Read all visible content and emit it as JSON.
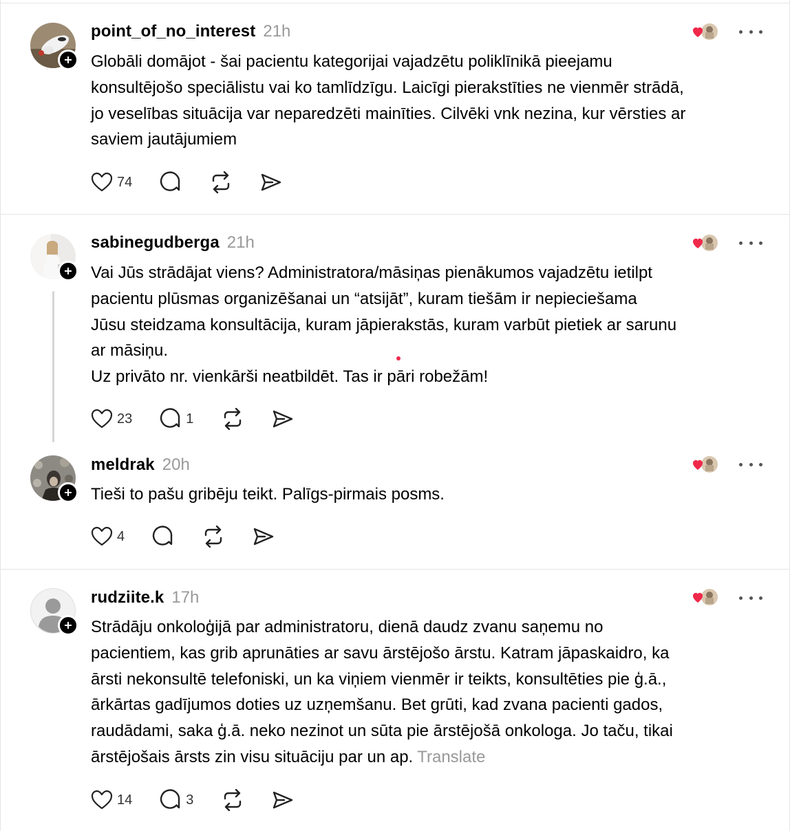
{
  "colors": {
    "heart": "#f0284a",
    "muted": "#999999",
    "divider": "#e5e5e5"
  },
  "posts": [
    {
      "username": "point_of_no_interest",
      "time": "21h",
      "avatar": "bird-photo",
      "text": "Globāli domājot - šai pacientu kategorijai vajadzētu poliklīnikā pieejamu\nkonsultējošo speciālistu vai ko tamlīdzīgu. Laicīgi pierakstīties ne vienmēr strādā,\njo veselības situācija var neparedzēti mainīties. Cilvēki vnk nezina, kur vērsties ar\nsaviem jautājumiem",
      "likes": "74",
      "replies": ""
    },
    {
      "username": "sabinegudberga",
      "time": "21h",
      "avatar": "person-photo",
      "text": "Vai Jūs strādājat viens? Administratora/māsiņas pienākumos vajadzētu ietilpt\npacientu plūsmas organizēšanai un “atsijāt”, kuram tiešām ir nepieciešama\nJūsu steidzama konsultācija, kuram jāpierakstās, kuram varbūt pietiek ar sarunu\nar māsiņu.\nUz privāto nr. vienkārši neatbildēt. Tas ir pāri robežām!",
      "likes": "23",
      "replies": "1"
    },
    {
      "username": "meldrak",
      "time": "20h",
      "avatar": "person-photo-dark",
      "text": "Tieši to pašu gribēju teikt. Palīgs-pirmais posms.",
      "likes": "4",
      "replies": ""
    },
    {
      "username": "rudziite.k",
      "time": "17h",
      "avatar": "default-avatar",
      "text": "Strādāju onkoloģijā par administratoru, dienā daudz zvanu saņemu no\npacientiem, kas grib aprunāties ar savu ārstējošo ārstu. Katram jāpaskaidro, ka\nārsti nekonsultē telefoniski, un ka viņiem vienmēr ir teikts, konsultēties pie ģ.ā.,\nārkārtas gadījumos doties uz uzņemšanu. Bet grūti, kad zvana pacienti gados,\nraudādami, saka ģ.ā. neko nezinot un sūta pie ārstējošā onkologa. Jo taču, tikai\nārstējošais ārsts zin visu situāciju par un ap.",
      "translate": "Translate",
      "likes": "14",
      "replies": "3"
    }
  ],
  "icons": {
    "like": "heart-icon",
    "reply": "comment-icon",
    "repost": "repost-icon",
    "share": "send-icon",
    "more": "more-icon",
    "follow": "plus-icon",
    "reactions": "liked-by-avatars"
  }
}
